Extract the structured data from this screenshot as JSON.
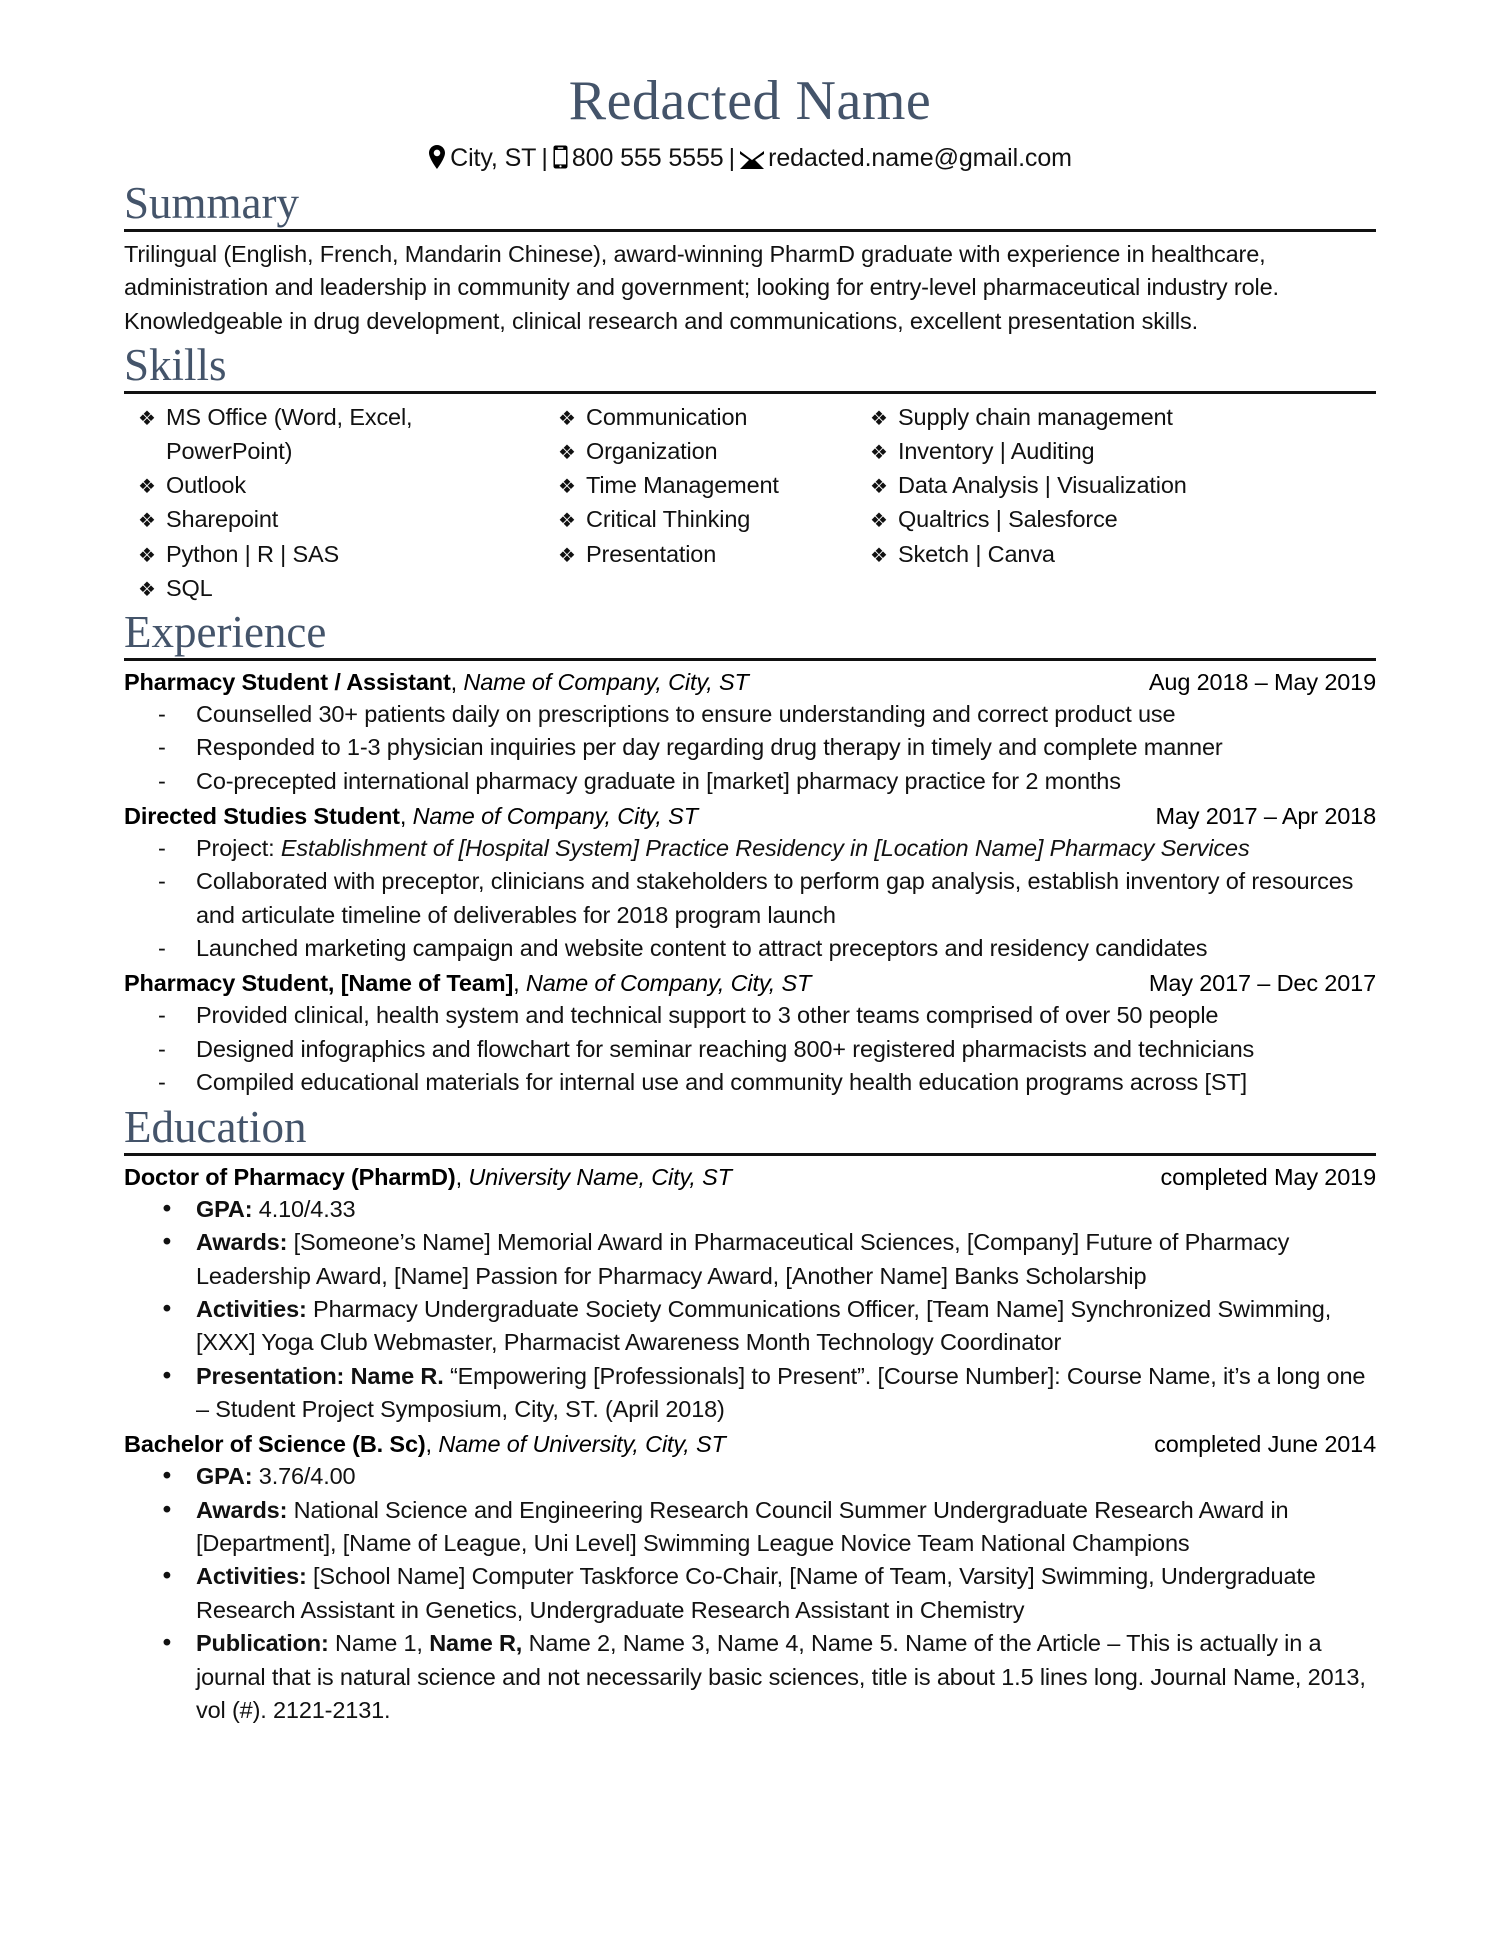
{
  "header": {
    "name": "Redacted Name",
    "location_icon": "location-pin-icon",
    "location": "City, ST",
    "sep1": "|",
    "phone_icon": "mobile-phone-icon",
    "phone": "800 555 5555",
    "sep2": "|",
    "email_icon": "envelope-icon",
    "email": "redacted.name@gmail.com"
  },
  "colors": {
    "heading": "#44546A",
    "rule": "#111111",
    "text": "#111111"
  },
  "sections": {
    "summary": {
      "title": "Summary",
      "text": "Trilingual (English, French, Mandarin Chinese), award-winning PharmD graduate with experience in healthcare, administration and leadership in community and government; looking for entry-level pharmaceutical industry role. Knowledgeable in drug development, clinical research and communications, excellent presentation skills."
    },
    "skills": {
      "title": "Skills",
      "bullet": "❖",
      "columns": [
        [
          "MS Office (Word, Excel, PowerPoint)",
          "Outlook",
          "Sharepoint",
          "Python | R | SAS",
          "SQL"
        ],
        [
          "Communication",
          "Organization",
          "Time Management",
          "Critical Thinking",
          "Presentation"
        ],
        [
          "Supply chain management",
          "Inventory | Auditing",
          "Data Analysis | Visualization",
          "Qualtrics | Salesforce",
          "Sketch | Canva"
        ]
      ]
    },
    "experience": {
      "title": "Experience",
      "bullet": "-",
      "entries": [
        {
          "title": "Pharmacy Student  / Assistant",
          "comma": ", ",
          "company": "Name of Company, City, ST",
          "dates": "Aug 2018 – May 2019",
          "bullets": [
            {
              "plain": "Counselled 30+ patients daily on prescriptions to ensure understanding and correct product use"
            },
            {
              "plain": "Responded to 1-3 physician inquiries per day regarding drug therapy in timely and complete manner"
            },
            {
              "plain": "Co-precepted international pharmacy graduate in [market] pharmacy practice for 2 months"
            }
          ]
        },
        {
          "title": "Directed Studies Student",
          "comma": ", ",
          "company": "Name of Company, City, ST",
          "dates": "May 2017 – Apr 2018",
          "bullets": [
            {
              "lead": "Project: ",
              "italic": "Establishment of [Hospital System] Practice Residency in  [Location Name] Pharmacy Services"
            },
            {
              "plain": "Collaborated with preceptor, clinicians and stakeholders to perform gap analysis, establish inventory of resources and articulate timeline of deliverables for 2018 program launch"
            },
            {
              "plain": "Launched marketing campaign and website content to attract preceptors and residency candidates"
            }
          ]
        },
        {
          "title": "Pharmacy Student,  [Name of Team]",
          "comma": ", ",
          "company": "Name of Company, City, ST",
          "dates": "May 2017 – Dec 2017",
          "bullets": [
            {
              "plain": "Provided clinical, health system and technical support to 3 other teams comprised of over 50 people"
            },
            {
              "plain": "Designed infographics and flowchart for seminar reaching 800+ registered pharmacists and technicians"
            },
            {
              "plain": "Compiled educational materials for internal use and community health education programs across  [ST]"
            }
          ]
        }
      ]
    },
    "education": {
      "title": "Education",
      "bullet": "•",
      "entries": [
        {
          "degree": "Doctor of Pharmacy (PharmD)",
          "comma": ", ",
          "school": "University Name, City, ST",
          "dates": "completed May 2019",
          "bullets": [
            {
              "label": "GPA:",
              "rest": " 4.10/4.33"
            },
            {
              "label": "Awards:",
              "rest": "  [Someone’s Name] Memorial Award in Pharmaceutical Sciences,  [Company] Future of Pharmacy Leadership Award,  [Name] Passion for Pharmacy Award,  [Another Name] Banks Scholarship"
            },
            {
              "label": "Activities:",
              "rest": " Pharmacy Undergraduate Society Communications Officer,  [Team Name] Synchronized Swimming,  [XXX] Yoga Club Webmaster, Pharmacist Awareness Month Technology Coordinator"
            },
            {
              "label": "Presentation: Name R.",
              "rest": " “Empowering  [Professionals] to Present”.  [Course Number]: Course Name, it’s a long one – Student Project Symposium, City, ST. (April 2018)"
            }
          ]
        },
        {
          "degree": "Bachelor of Science (B. Sc)",
          "comma": ",  ",
          "school": "Name of University, City, ST",
          "dates": "completed June 2014",
          "bullets": [
            {
              "label": "GPA:",
              "rest": " 3.76/4.00"
            },
            {
              "label": "Awards:",
              "rest": " National Science and Engineering Research Council Summer Undergraduate Research Award in  [Department],  [Name of League, Uni Level] Swimming League Novice Team National Champions"
            },
            {
              "label": "Activities:",
              "rest": "  [School Name] Computer Taskforce Co-Chair,  [Name of Team, Varsity] Swimming, Undergraduate Research Assistant in Genetics, Undergraduate Research Assistant in Chemistry"
            },
            {
              "label": "Publication:",
              "rest_a": " Name 1, ",
              "bold_mid": "Name R,",
              "rest_b": " Name 2, Name 3, Name 4, Name 5. Name of the Article – This is actually in a journal that is natural science and not necessarily basic sciences, title is about 1.5 lines long. Journal Name, 2013, vol (#). 2121-2131."
            }
          ]
        }
      ]
    }
  }
}
